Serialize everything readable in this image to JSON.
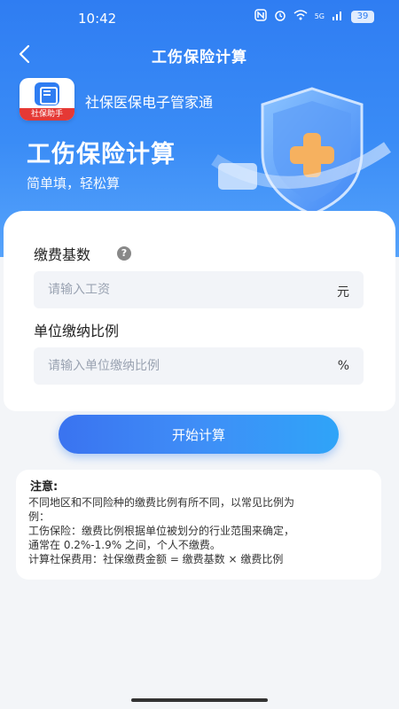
{
  "status_bar": {
    "time": "10:42",
    "icons": [
      "nfc-icon",
      "alarm-icon",
      "wifi-icon",
      "cellular-icon"
    ],
    "network": "5G",
    "battery": "39"
  },
  "nav": {
    "back_icon": "chevron-left-icon",
    "title": "工伤保险计算"
  },
  "brand": {
    "logo_text": "社保助手",
    "name": "社保医保电子管家通"
  },
  "hero": {
    "title": "工伤保险计算",
    "subtitle": "简单填，轻松算"
  },
  "form": {
    "base": {
      "label": "缴费基数",
      "placeholder": "请输入工资",
      "unit": "元",
      "value": ""
    },
    "ratio": {
      "label": "单位缴纳比例",
      "placeholder": "请输入单位缴纳比例",
      "unit": "%",
      "value": ""
    },
    "help_icon": "question-icon"
  },
  "actions": {
    "start_label": "开始计算"
  },
  "notes": {
    "title": "注意:",
    "lines": [
      "不同地区和不同险种的缴费比例有所不同，以常见比例为",
      "例：",
      "工伤保险：缴费比例根据单位被划分的行业范围来确定，",
      "通常在 0.2%-1.9% 之间，个人不缴费。",
      "计算社保费用：社保缴费金额 = 缴费基数 × 缴费比例"
    ]
  },
  "colors": {
    "primary": "#2f7df2",
    "button_start": "#3a73f0",
    "button_end": "#2fa4f8",
    "shield_plus": "#f6b15f"
  }
}
